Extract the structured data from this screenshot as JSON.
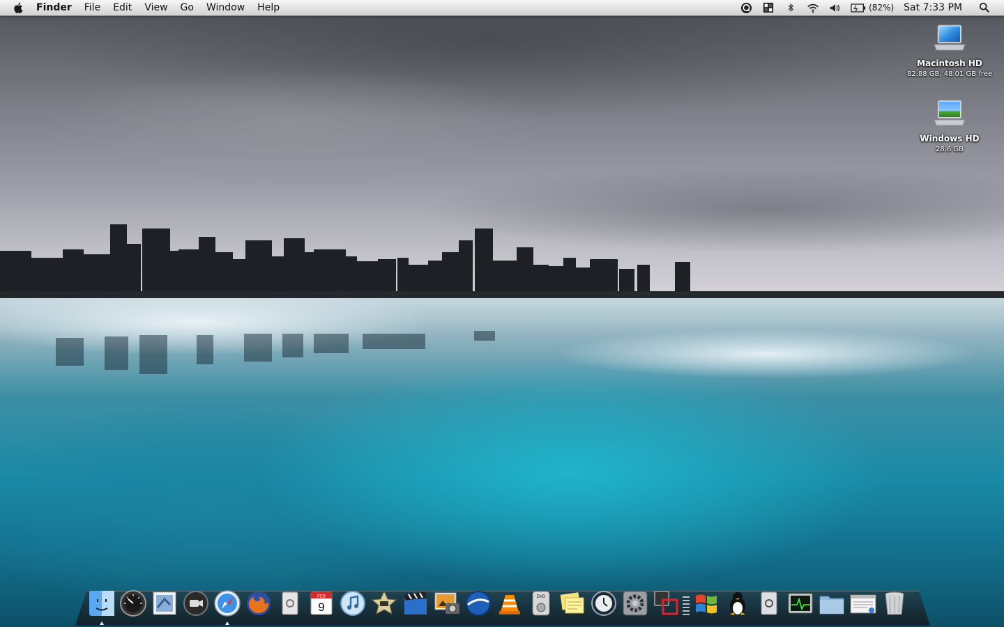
{
  "menubar": {
    "apple_icon": "apple-logo-icon",
    "app_name": "Finder",
    "menus": [
      "File",
      "Edit",
      "View",
      "Go",
      "Window",
      "Help"
    ],
    "status_icons": [
      "user-account-icon",
      "spaces-icon",
      "bluetooth-icon",
      "wifi-icon",
      "volume-icon",
      "battery-icon"
    ],
    "battery_percent": "(82%)",
    "clock": "Sat 7:33 PM",
    "spotlight_icon": "spotlight-search-icon"
  },
  "desktop": {
    "icons": [
      {
        "label": "Macintosh HD",
        "info": "82.88 GB, 48.01 GB free",
        "icon": "macintosh-hd-drive-icon"
      },
      {
        "label": "Windows HD",
        "info": "28.6 GB",
        "icon": "windows-hd-drive-icon"
      }
    ]
  },
  "dock": {
    "apps": [
      {
        "name": "finder",
        "running": true
      },
      {
        "name": "dashboard",
        "running": false
      },
      {
        "name": "mail-stamp",
        "running": false
      },
      {
        "name": "facetime-camera",
        "running": false
      },
      {
        "name": "safari",
        "running": true
      },
      {
        "name": "firefox",
        "running": false
      },
      {
        "name": "address-book",
        "running": false
      },
      {
        "name": "ical",
        "running": false
      },
      {
        "name": "itunes",
        "running": false
      },
      {
        "name": "imovie",
        "running": false
      },
      {
        "name": "final-cut",
        "running": false
      },
      {
        "name": "iphoto",
        "running": false
      },
      {
        "name": "google-earth",
        "running": false
      },
      {
        "name": "vlc",
        "running": false
      },
      {
        "name": "dvd-player",
        "running": false
      },
      {
        "name": "stickies",
        "running": false
      },
      {
        "name": "time-machine",
        "running": false
      },
      {
        "name": "system-preferences",
        "running": false
      },
      {
        "name": "boot-camp",
        "running": false
      }
    ],
    "stacks": [
      {
        "name": "windows"
      },
      {
        "name": "linux-tux"
      },
      {
        "name": "mail-folder"
      },
      {
        "name": "activity-monitor"
      },
      {
        "name": "documents-folder"
      },
      {
        "name": "network-window"
      },
      {
        "name": "trash"
      }
    ],
    "calendar_month": "FEB",
    "calendar_day": "9",
    "dvd_label": "DVD"
  }
}
